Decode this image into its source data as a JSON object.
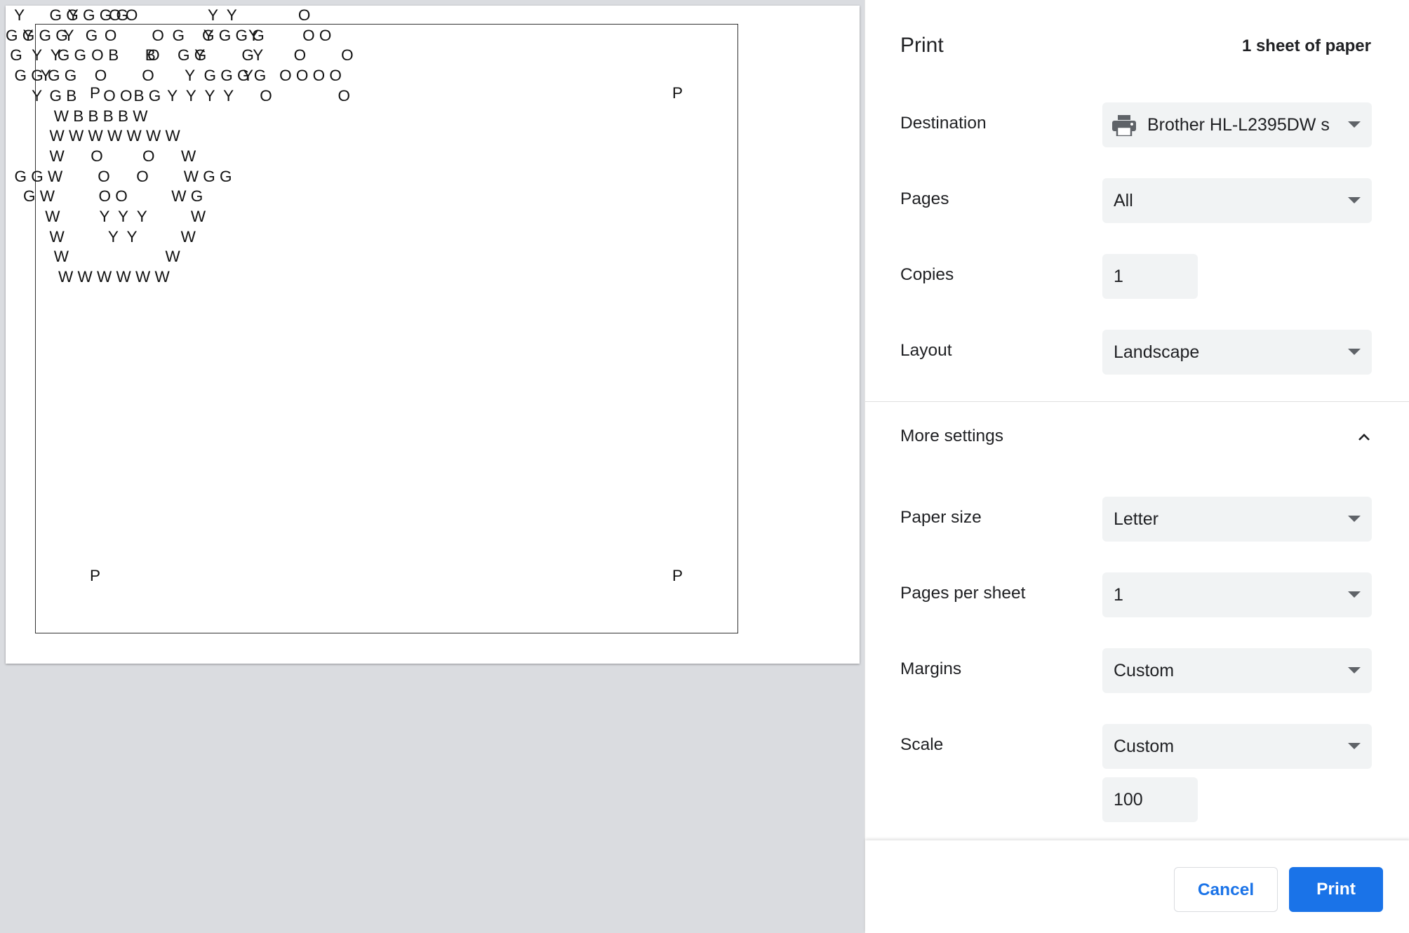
{
  "preview": {
    "art_top": [
      "          G G G G G",
      "G G G G    G                 G    G G G G",
      " G        G G     B      B     G G        G",
      "  G G G G                             G G G G",
      "          G B             B G",
      "           W B B B B W",
      "          W W W W W W W",
      "          W      O         O      W",
      "  G G W        O      O        W G G",
      "    G W          O O          W G",
      "         W         Y  Y  Y          W",
      "          W          Y  Y          W",
      "           W                      W",
      "            W W W W W W"
    ],
    "art_bottom": [
      "  Y          Y       O O                Y  Y              O",
      "    Y       Y       O        O         Y        Y          O O",
      "      Y  Y       O          O        Y           Y       O        O",
      "        Y          O        O       Y           Y      O O O O",
      "      Y              O O        Y  Y  Y  Y      O               O"
    ],
    "corner_marks": [
      "P",
      "P",
      "P",
      "P"
    ]
  },
  "settings": {
    "title": "Print",
    "sheet_count": "1 sheet of paper",
    "destination": {
      "label": "Destination",
      "value": "Brother HL-L2395DW s"
    },
    "pages": {
      "label": "Pages",
      "value": "All"
    },
    "copies": {
      "label": "Copies",
      "value": "1"
    },
    "layout": {
      "label": "Layout",
      "value": "Landscape"
    },
    "more_settings": {
      "label": "More settings"
    },
    "paper_size": {
      "label": "Paper size",
      "value": "Letter"
    },
    "pages_per_sheet": {
      "label": "Pages per sheet",
      "value": "1"
    },
    "margins": {
      "label": "Margins",
      "value": "Custom"
    },
    "scale": {
      "label": "Scale",
      "value": "Custom",
      "custom_value": "100"
    }
  },
  "footer": {
    "cancel_label": "Cancel",
    "print_label": "Print"
  },
  "colors": {
    "accent": "#1a73e8",
    "field_bg": "#f1f3f4",
    "preview_bg": "#dadce0"
  },
  "icons": {
    "destination": "printer-icon",
    "dropdown": "caret-down-icon",
    "more_settings": "chevron-up-icon"
  }
}
